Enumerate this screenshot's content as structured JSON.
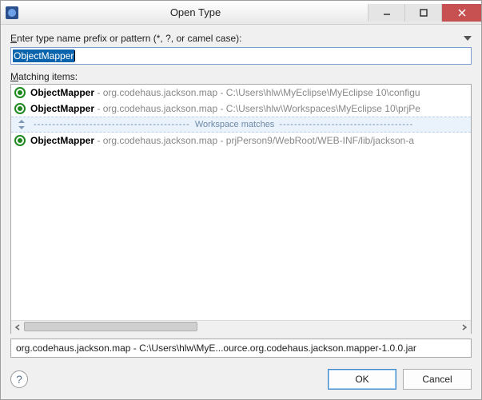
{
  "window": {
    "title": "Open Type"
  },
  "prompt_label": "nter type name prefix or pattern (*, ?, or camel case):",
  "prompt_label_key": "E",
  "input": {
    "value": "ObjectMapper"
  },
  "matching_label_key": "M",
  "matching_label": "atching items:",
  "items": [
    {
      "name": "ObjectMapper",
      "pkg": "org.codehaus.jackson.map",
      "loc": "C:\\Users\\hlw\\MyEclipse\\MyEclipse 10\\configu"
    },
    {
      "name": "ObjectMapper",
      "pkg": "org.codehaus.jackson.map",
      "loc": "C:\\Users\\hlw\\Workspaces\\MyEclipse 10\\prjPe"
    }
  ],
  "divider": {
    "left_dashes": "------------------------------------------",
    "label": "Workspace matches",
    "right_dashes": "------------------------------------"
  },
  "items_ws": [
    {
      "name": "ObjectMapper",
      "pkg": "org.codehaus.jackson.map",
      "loc": "prjPerson9/WebRoot/WEB-INF/lib/jackson-a"
    }
  ],
  "status": "org.codehaus.jackson.map - C:\\Users\\hlw\\MyE...ource.org.codehaus.jackson.mapper-1.0.0.jar",
  "buttons": {
    "ok": "OK",
    "cancel": "Cancel"
  },
  "help_glyph": "?"
}
